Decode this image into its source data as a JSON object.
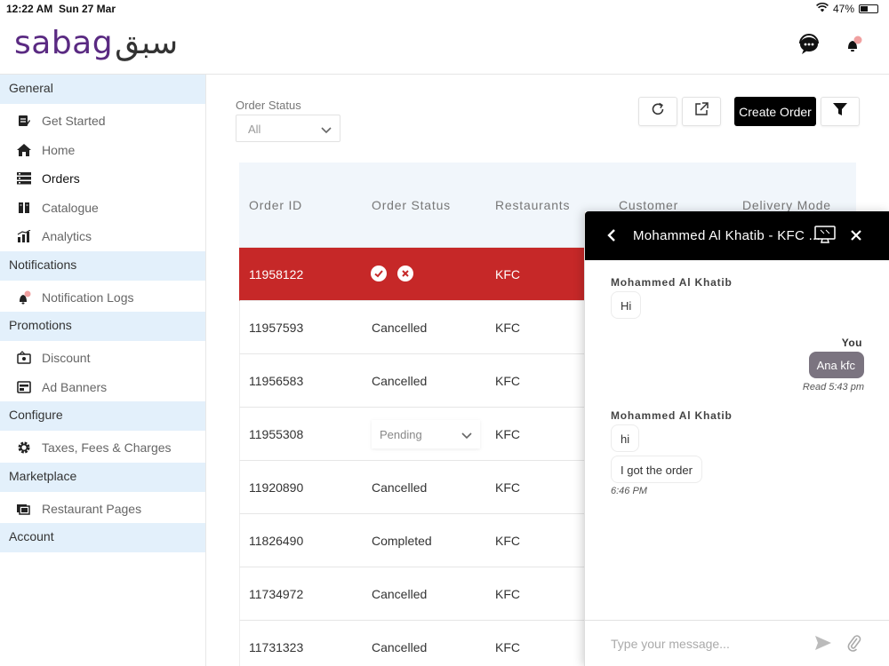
{
  "status_bar": {
    "time": "12:22 AM",
    "date": "Sun 27 Mar",
    "battery": "47%",
    "battery_level": 0.47
  },
  "header": {
    "logo_latin": "sabag",
    "logo_arabic": "سبق"
  },
  "sidebar": {
    "sections": [
      {
        "title": "General",
        "items": [
          {
            "label": "Get Started",
            "icon": "get-started-icon"
          },
          {
            "label": "Home",
            "icon": "home-icon"
          },
          {
            "label": "Orders",
            "icon": "orders-icon",
            "active": true
          },
          {
            "label": "Catalogue",
            "icon": "catalogue-icon"
          },
          {
            "label": "Analytics",
            "icon": "analytics-icon"
          }
        ]
      },
      {
        "title": "Notifications",
        "items": [
          {
            "label": "Notification Logs",
            "icon": "bell-icon"
          }
        ]
      },
      {
        "title": "Promotions",
        "items": [
          {
            "label": "Discount",
            "icon": "discount-icon"
          },
          {
            "label": "Ad Banners",
            "icon": "ad-banners-icon"
          }
        ]
      },
      {
        "title": "Configure",
        "items": [
          {
            "label": "Taxes, Fees & Charges",
            "icon": "gear-icon"
          }
        ]
      },
      {
        "title": "Marketplace",
        "items": [
          {
            "label": "Restaurant Pages",
            "icon": "restaurant-pages-icon"
          }
        ]
      },
      {
        "title": "Account",
        "items": []
      }
    ]
  },
  "filters": {
    "order_status_label": "Order Status",
    "order_status_value": "All"
  },
  "toolbar": {
    "create_order_label": "Create Order"
  },
  "table": {
    "columns": [
      "Order ID",
      "Order Status",
      "Restaurants",
      "Customer",
      "Delivery Mode"
    ],
    "rows": [
      {
        "id": "11958122",
        "status": "",
        "restaurant": "KFC",
        "selected": true
      },
      {
        "id": "11957593",
        "status": "Cancelled",
        "restaurant": "KFC"
      },
      {
        "id": "11956583",
        "status": "Cancelled",
        "restaurant": "KFC"
      },
      {
        "id": "11955308",
        "status": "Pending",
        "restaurant": "KFC",
        "status_dropdown": true
      },
      {
        "id": "11920890",
        "status": "Cancelled",
        "restaurant": "KFC"
      },
      {
        "id": "11826490",
        "status": "Completed",
        "restaurant": "KFC"
      },
      {
        "id": "11734972",
        "status": "Cancelled",
        "restaurant": "KFC"
      },
      {
        "id": "11731323",
        "status": "Cancelled",
        "restaurant": "KFC"
      }
    ]
  },
  "chat": {
    "title": "Mohammed Al Khatib - KFC ...",
    "messages": [
      {
        "from": "Mohammed Al Khatib",
        "direction": "in",
        "bubbles": [
          "Hi"
        ]
      },
      {
        "from": "You",
        "direction": "out",
        "bubbles": [
          "Ana kfc"
        ],
        "meta": "Read 5:43 pm"
      },
      {
        "from": "Mohammed Al Khatib",
        "direction": "in",
        "bubbles": [
          "hi",
          "I got the order"
        ],
        "meta": "6:46 PM"
      }
    ],
    "input_placeholder": "Type your message..."
  },
  "colors": {
    "brand": "#5a2a82",
    "selected_row": "#c62828",
    "section_bg": "#e3f0fb",
    "outgoing_bubble": "#7b7480"
  }
}
